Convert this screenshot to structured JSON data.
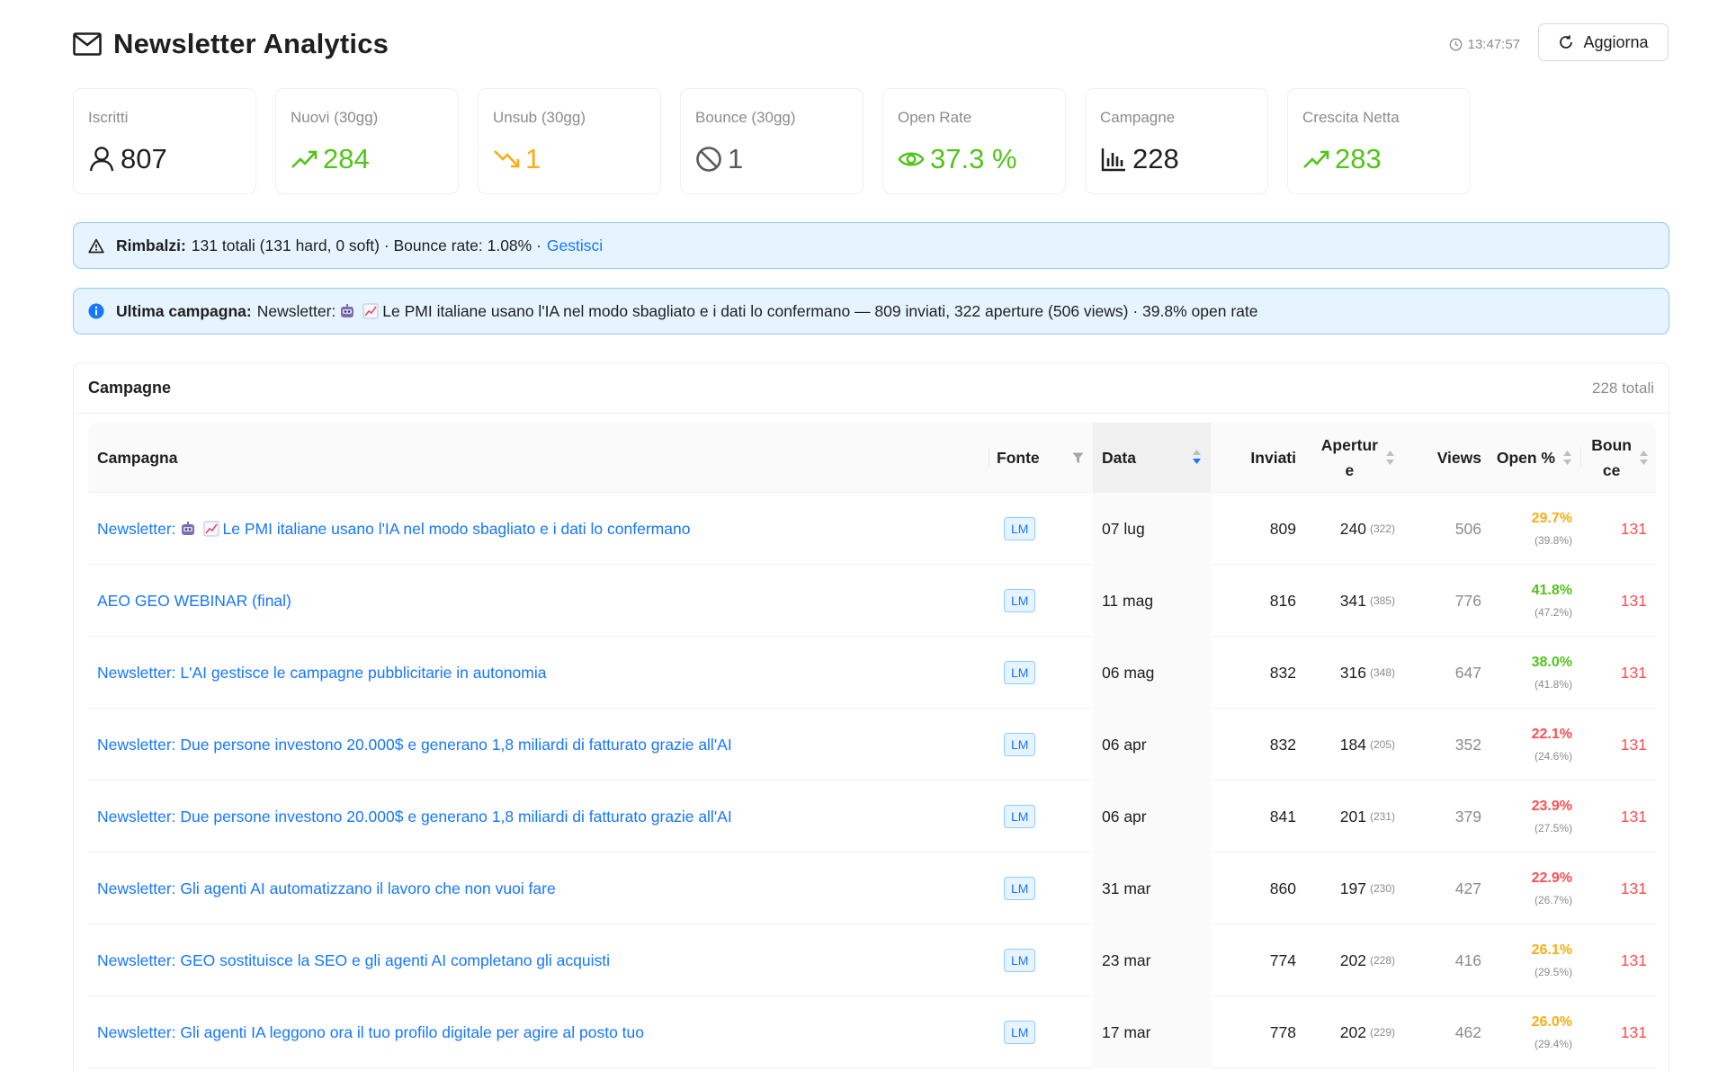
{
  "header": {
    "title": "Newsletter Analytics",
    "time": "13:47:57",
    "refresh_label": "Aggiorna"
  },
  "stats": [
    {
      "label": "Iscritti",
      "value": "807",
      "icon": "user-icon",
      "color": "#1f1f1f"
    },
    {
      "label": "Nuovi (30gg)",
      "value": "284",
      "icon": "trend-up-icon",
      "color": "#52c41a"
    },
    {
      "label": "Unsub (30gg)",
      "value": "1",
      "icon": "trend-down-icon",
      "color": "#faad14"
    },
    {
      "label": "Bounce (30gg)",
      "value": "1",
      "icon": "stop-icon",
      "color": "#595959"
    },
    {
      "label": "Open Rate",
      "value": "37.3 %",
      "icon": "eye-icon",
      "color": "#52c41a"
    },
    {
      "label": "Campagne",
      "value": "228",
      "icon": "bar-chart-icon",
      "color": "#1f1f1f"
    },
    {
      "label": "Crescita Netta",
      "value": "283",
      "icon": "trend-up-icon",
      "color": "#52c41a"
    }
  ],
  "bounce_alert": {
    "label": "Rimbalzi:",
    "text": "131 totali (131 hard, 0 soft) · Bounce rate: 1.08% ·",
    "link": "Gestisci"
  },
  "last_campaign_alert": {
    "label": "Ultima campagna:",
    "prefix": "Newsletter:",
    "text": "Le PMI italiane usano l'IA nel modo sbagliato e i dati lo confermano — 809 inviati, 322 aperture (506 views) · 39.8% open rate"
  },
  "campaigns": {
    "title": "Campagne",
    "total": "228 totali",
    "columns": {
      "campaign": "Campagna",
      "source": "Fonte",
      "date": "Data",
      "sent": "Inviati",
      "opens_1": "Apertur",
      "opens_2": "e",
      "views": "Views",
      "open_pct": "Open %",
      "bounce_1": "Boun",
      "bounce_2": "ce"
    },
    "rows": [
      {
        "name": "Le PMI italiane usano l'IA nel modo sbagliato e i dati lo confermano",
        "prefix": "Newsletter:",
        "emoji": true,
        "source": "LM",
        "date": "07 lug",
        "sent": "809",
        "opens": "240",
        "opens_total": "(322)",
        "views": "506",
        "open_pct": "29.7%",
        "open_pct_total": "(39.8%)",
        "rate_color": "#faad14",
        "bounce": "131"
      },
      {
        "name": "AEO GEO WEBINAR (final)",
        "prefix": "",
        "emoji": false,
        "source": "LM",
        "date": "11 mag",
        "sent": "816",
        "opens": "341",
        "opens_total": "(385)",
        "views": "776",
        "open_pct": "41.8%",
        "open_pct_total": "(47.2%)",
        "rate_color": "#52c41a",
        "bounce": "131"
      },
      {
        "name": "Newsletter: L'AI gestisce le campagne pubblicitarie in autonomia",
        "prefix": "",
        "emoji": false,
        "source": "LM",
        "date": "06 mag",
        "sent": "832",
        "opens": "316",
        "opens_total": "(348)",
        "views": "647",
        "open_pct": "38.0%",
        "open_pct_total": "(41.8%)",
        "rate_color": "#52c41a",
        "bounce": "131"
      },
      {
        "name": "Newsletter: Due persone investono 20.000$ e generano 1,8 miliardi di fatturato grazie all'AI",
        "prefix": "",
        "emoji": false,
        "source": "LM",
        "date": "06 apr",
        "sent": "832",
        "opens": "184",
        "opens_total": "(205)",
        "views": "352",
        "open_pct": "22.1%",
        "open_pct_total": "(24.6%)",
        "rate_color": "#ff4d4f",
        "bounce": "131"
      },
      {
        "name": "Newsletter: Due persone investono 20.000$ e generano 1,8 miliardi di fatturato grazie all'AI",
        "prefix": "",
        "emoji": false,
        "source": "LM",
        "date": "06 apr",
        "sent": "841",
        "opens": "201",
        "opens_total": "(231)",
        "views": "379",
        "open_pct": "23.9%",
        "open_pct_total": "(27.5%)",
        "rate_color": "#ff4d4f",
        "bounce": "131"
      },
      {
        "name": "Newsletter: Gli agenti AI automatizzano il lavoro che non vuoi fare",
        "prefix": "",
        "emoji": false,
        "source": "LM",
        "date": "31 mar",
        "sent": "860",
        "opens": "197",
        "opens_total": "(230)",
        "views": "427",
        "open_pct": "22.9%",
        "open_pct_total": "(26.7%)",
        "rate_color": "#ff4d4f",
        "bounce": "131"
      },
      {
        "name": "Newsletter: GEO sostituisce la SEO e gli agenti AI completano gli acquisti",
        "prefix": "",
        "emoji": false,
        "source": "LM",
        "date": "23 mar",
        "sent": "774",
        "opens": "202",
        "opens_total": "(228)",
        "views": "416",
        "open_pct": "26.1%",
        "open_pct_total": "(29.5%)",
        "rate_color": "#faad14",
        "bounce": "131"
      },
      {
        "name": "Newsletter: Gli agenti IA leggono ora il tuo profilo digitale per agire al posto tuo",
        "prefix": "",
        "emoji": false,
        "source": "LM",
        "date": "17 mar",
        "sent": "778",
        "opens": "202",
        "opens_total": "(229)",
        "views": "462",
        "open_pct": "26.0%",
        "open_pct_total": "(29.4%)",
        "rate_color": "#faad14",
        "bounce": "131"
      }
    ]
  }
}
